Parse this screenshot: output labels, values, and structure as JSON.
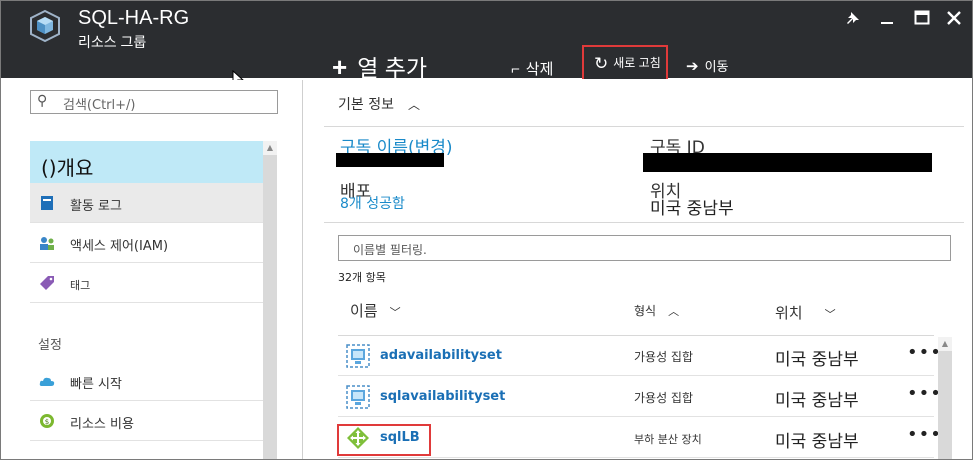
{
  "header": {
    "title": "SQL-HA-RG",
    "subtitle": "리소스 그룹",
    "commands": {
      "add_label": "열 추가",
      "delete_label": "삭제",
      "refresh_label": "새로 고침",
      "move_label": "이동"
    },
    "window_controls": [
      "pin-icon",
      "minimize-icon",
      "maximize-icon",
      "close-icon"
    ]
  },
  "sidebar": {
    "search_placeholder": "검색(Ctrl+/)",
    "items": [
      {
        "label": "()개요",
        "icon": "overview-icon",
        "selected": true
      },
      {
        "label": "활동 로그",
        "icon": "activity-log-icon"
      },
      {
        "label": "액세스 제어(IAM)",
        "icon": "iam-icon"
      },
      {
        "label": "태그",
        "icon": "tag-icon"
      }
    ],
    "section_label": "설정",
    "settings_items": [
      {
        "label": "빠른 시작",
        "icon": "quickstart-cloud-icon"
      },
      {
        "label": "리소스 비용",
        "icon": "cost-icon"
      }
    ]
  },
  "essentials": {
    "toggle_label": "기본 정보",
    "subscription_name_label": "구독 이름(변경)",
    "subscription_id_label": "구독 ID",
    "deployments_label": "배포",
    "deployments_value": "8개 성공함",
    "location_label": "위치",
    "location_value": "미국 중남부"
  },
  "resources": {
    "filter_placeholder": "이름별 필터링.",
    "item_count": "32개 항목",
    "columns": {
      "name": "이름",
      "type": "형식",
      "location": "위치"
    },
    "rows": [
      {
        "name": "adavailabilityset",
        "type": "가용성 집합",
        "location": "미국 중남부",
        "icon": "availability-set-icon",
        "more": "•••"
      },
      {
        "name": "sqlavailabilityset",
        "type": "가용성 집합",
        "location": "미국 중남부",
        "icon": "availability-set-icon",
        "more": "•••"
      },
      {
        "name": "sqlLB",
        "type": "부하 분산 장치",
        "location": "미국 중남부",
        "icon": "load-balancer-icon",
        "more": "•••"
      }
    ]
  },
  "colors": {
    "header_bg": "#2b2d30",
    "selected_nav_bg": "#bfe9f7",
    "link": "#1a8ac9",
    "highlight_box": "#e03a3a"
  }
}
